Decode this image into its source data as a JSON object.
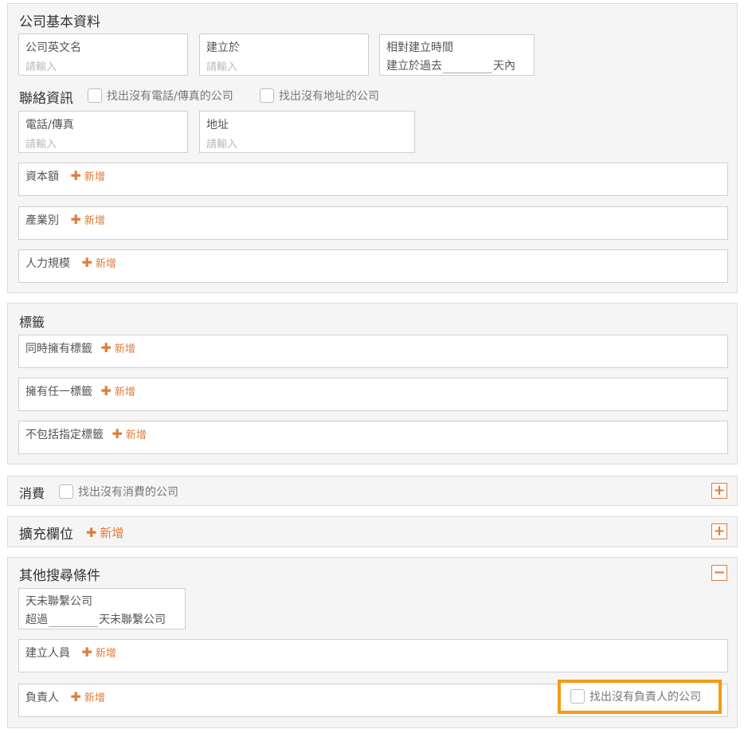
{
  "basic": {
    "title": "公司基本資料",
    "english_name": {
      "label": "公司英文名",
      "placeholder": "請輸入"
    },
    "founded": {
      "label": "建立於",
      "placeholder": "請輸入"
    },
    "relative": {
      "label": "相對建立時間",
      "prefix": "建立於過去",
      "suffix": "天內"
    },
    "contact_title": "聯絡資訊",
    "no_phone_label": "找出沒有電話/傳真的公司",
    "no_address_label": "找出沒有地址的公司",
    "phone": {
      "label": "電話/傳真",
      "placeholder": "請輸入"
    },
    "address": {
      "label": "地址",
      "placeholder": "請輸入"
    },
    "capital": {
      "label": "資本額",
      "add": "新增"
    },
    "industry": {
      "label": "產業別",
      "add": "新增"
    },
    "headcount": {
      "label": "人力規模",
      "add": "新增"
    }
  },
  "tags": {
    "title": "標籤",
    "all": {
      "label": "同時擁有標籤",
      "add": "新增"
    },
    "any": {
      "label": "擁有任一標籤",
      "add": "新增"
    },
    "exclude": {
      "label": "不包括指定標籤",
      "add": "新增"
    }
  },
  "consumption": {
    "title": "消費",
    "no_consumption_label": "找出沒有消費的公司",
    "toggle": "+"
  },
  "extended": {
    "title": "擴充欄位",
    "add": "新增",
    "toggle": "+"
  },
  "other": {
    "title": "其他搜尋條件",
    "toggle": "−",
    "uncontacted": {
      "label": "天未聯繫公司",
      "prefix": "超過",
      "suffix": "天未聯繫公司"
    },
    "creator": {
      "label": "建立人員",
      "add": "新增"
    },
    "owner": {
      "label": "負責人",
      "add": "新增",
      "no_owner_label": "找出沒有負責人的公司"
    }
  },
  "colors": {
    "accent": "#e07b39",
    "highlight": "#f39c12"
  }
}
